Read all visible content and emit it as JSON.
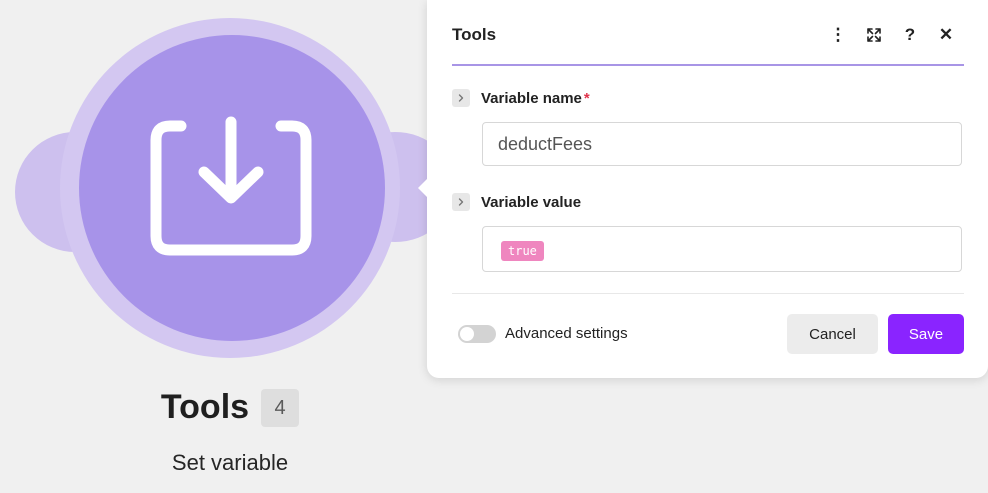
{
  "module": {
    "icon": "import-tray-icon",
    "title": "Tools",
    "badge": "4",
    "subtitle": "Set variable",
    "color": "#a793e9"
  },
  "panel": {
    "title": "Tools",
    "header_buttons": {
      "more": "⋮",
      "expand_icon": "expand-icon",
      "help": "?",
      "close": "✕"
    },
    "fields": [
      {
        "label": "Variable name",
        "required_mark": "*",
        "value": "deductFees"
      },
      {
        "label": "Variable value",
        "token": "true"
      }
    ],
    "advanced_settings_label": "Advanced settings",
    "cancel_label": "Cancel",
    "save_label": "Save",
    "accent_color": "#8a24ff"
  }
}
